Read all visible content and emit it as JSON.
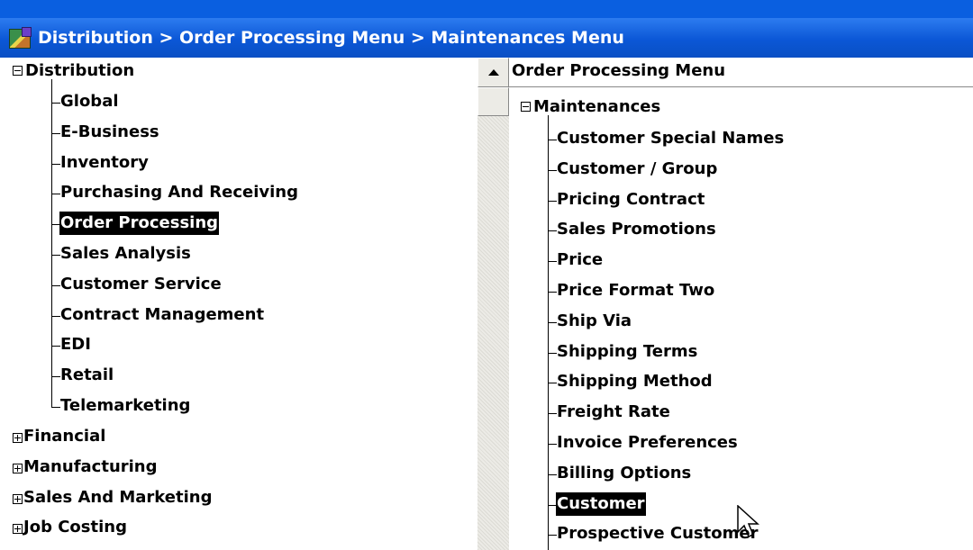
{
  "window": {
    "title": "Distribution > Order Processing Menu > Maintenances Menu",
    "icon": "app-icon"
  },
  "left_tree": {
    "root": "Distribution",
    "children": [
      "Global",
      "E-Business",
      "Inventory",
      "Purchasing And Receiving",
      "Order Processing",
      "Sales Analysis",
      "Customer Service",
      "Contract Management",
      "EDI",
      "Retail",
      "Telemarketing"
    ],
    "selected_index": 4,
    "collapsed": [
      "Financial",
      "Manufacturing",
      "Sales And Marketing",
      "Job Costing"
    ]
  },
  "right_tree": {
    "header": "Order Processing Menu",
    "group": "Maintenances",
    "children": [
      "Customer Special Names",
      "Customer / Group",
      "Pricing Contract",
      "Sales Promotions",
      "Price",
      "Price Format Two",
      "Ship Via",
      "Shipping Terms",
      "Shipping Method",
      "Freight Rate",
      "Invoice Preferences",
      "Billing Options",
      "Customer",
      "Prospective Customer"
    ],
    "selected_index": 12
  },
  "colors": {
    "titlebar": "#0b57d6",
    "selection": "#000000"
  }
}
